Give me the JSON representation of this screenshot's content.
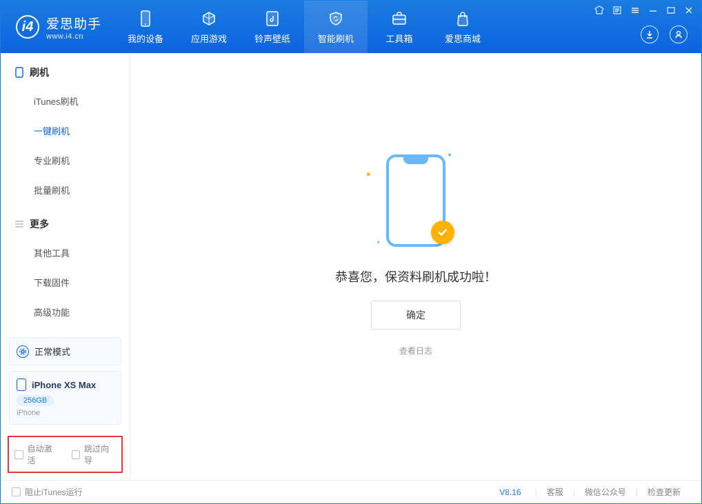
{
  "logo": {
    "cn": "爱思助手",
    "url": "www.i4.cn"
  },
  "nav": {
    "device": "我的设备",
    "apps": "应用游戏",
    "ringtone": "铃声壁纸",
    "flash": "智能刷机",
    "toolbox": "工具箱",
    "store": "爱思商城"
  },
  "sidebar": {
    "section_flash": "刷机",
    "items_flash": [
      "iTunes刷机",
      "一键刷机",
      "专业刷机",
      "批量刷机"
    ],
    "section_more": "更多",
    "items_more": [
      "其他工具",
      "下载固件",
      "高级功能"
    ]
  },
  "device_mode": {
    "label": "正常模式"
  },
  "device_info": {
    "name": "iPhone XS Max",
    "storage": "256GB",
    "type": "iPhone"
  },
  "options": {
    "auto_activate": "自动激活",
    "skip_wizard": "跳过向导"
  },
  "main": {
    "success": "恭喜您，保资料刷机成功啦！",
    "ok": "确定",
    "view_log": "查看日志"
  },
  "footer": {
    "block_itunes": "阻止iTunes运行",
    "version": "V8.16",
    "support": "客服",
    "wechat": "微信公众号",
    "update": "检查更新"
  }
}
